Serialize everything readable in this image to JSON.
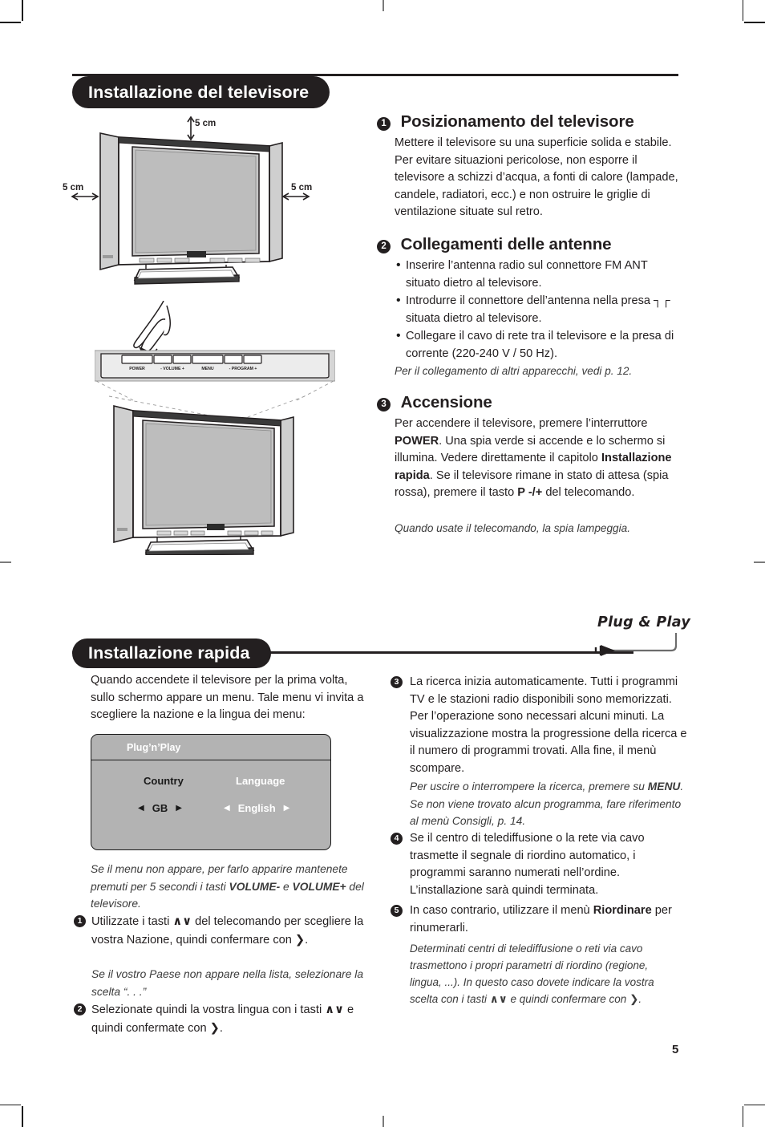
{
  "page": {
    "number": "5",
    "language": "it"
  },
  "section1": {
    "banner": "Installazione del televisore",
    "illustration": {
      "dim_top": "5 cm",
      "dim_left": "5 cm",
      "dim_right": "5 cm",
      "control_panel_labels": [
        "POWER",
        "- VOLUME +",
        "MENU",
        "- PROGRAM +"
      ]
    },
    "items": [
      {
        "num": "1",
        "heading": "Posizionamento del televisore",
        "body": "Mettere il televisore su una superficie solida e stabile. Per evitare situazioni pericolose, non esporre il televisore a schizzi d’acqua, a fonti di calore (lampade, candele, radiatori, ecc.) e non ostruire le griglie di ventilazione situate sul retro."
      },
      {
        "num": "2",
        "heading": "Collegamenti delle antenne",
        "bullets": [
          "Inserire l’antenna radio sul connettore FM ANT situato dietro al televisore.",
          "Introdurre il connettore dell’antenna nella presa ┐┌ situata dietro al televisore.",
          "Collegare il cavo di rete tra il televisore e la presa di corrente (220-240 V / 50 Hz)."
        ],
        "note": "Per il collegamento di altri apparecchi, vedi p. 12."
      },
      {
        "num": "3",
        "heading": "Accensione",
        "body_parts": [
          {
            "t": "Per accendere il televisore, premere l’interruttore ",
            "b": false
          },
          {
            "t": "POWER",
            "b": true
          },
          {
            "t": ". Una spia verde si accende e lo schermo si illumina. Vedere direttamente il capitolo ",
            "b": false
          },
          {
            "t": "Installazione rapida",
            "b": true
          },
          {
            "t": ". Se il televisore rimane in stato di attesa (spia rossa), premere il tasto ",
            "b": false
          },
          {
            "t": "P -/+",
            "b": true
          },
          {
            "t": " del telecomando.",
            "b": false
          }
        ],
        "note": "Quando usate il telecomando, la spia lampeggia."
      }
    ]
  },
  "section2": {
    "banner": "Installazione rapida",
    "logo": "Plug & Play",
    "intro": "Quando accendete il televisore per la prima volta, sullo schermo appare un menu. Tale menu vi invita a scegliere la nazione e la lingua dei menu:",
    "osd": {
      "title": "Plug’n’Play",
      "country_label": "Country",
      "language_label": "Language",
      "country_value": "GB",
      "language_value": "English",
      "arrow_left": "◀",
      "arrow_right": "▶"
    },
    "note_after_osd": [
      {
        "t": "Se il menu non appare, per farlo apparire mantenete premuti per 5 secondi i tasti ",
        "b": false
      },
      {
        "t": "VOLUME-",
        "b": true
      },
      {
        "t": " e ",
        "b": false
      },
      {
        "t": "VOLUME+",
        "b": true
      },
      {
        "t": " del televisore.",
        "b": false
      }
    ],
    "left_items": [
      {
        "num": "1",
        "parts": [
          {
            "t": "Utilizzate i tasti ",
            "b": false,
            "g": false
          },
          {
            "t": "∧∨",
            "b": true,
            "g": true
          },
          {
            "t": " del telecomando per scegliere la vostra Nazione, quindi confermare con ",
            "b": false,
            "g": false
          },
          {
            "t": "❯",
            "b": true,
            "g": true
          },
          {
            "t": ".",
            "b": false,
            "g": false
          }
        ],
        "note": "Se il vostro Paese non appare nella lista, selezionare la scelta “. . .”"
      },
      {
        "num": "2",
        "parts": [
          {
            "t": "Selezionate quindi la vostra lingua con i tasti ",
            "b": false,
            "g": false
          },
          {
            "t": "∧∨",
            "b": true,
            "g": true
          },
          {
            "t": " e quindi confermate con ",
            "b": false,
            "g": false
          },
          {
            "t": "❯",
            "b": true,
            "g": true
          },
          {
            "t": ".",
            "b": false,
            "g": false
          }
        ]
      }
    ],
    "right_items": [
      {
        "num": "3",
        "body": "La ricerca inizia automaticamente. Tutti i programmi TV e le stazioni radio disponibili sono memorizzati. Per l’operazione sono necessari alcuni minuti. La visualizzazione mostra la progressione della ricerca e il numero di programmi trovati. Alla fine, il menù scompare.",
        "note_parts": [
          {
            "t": "Per uscire o interrompere la ricerca, premere su ",
            "b": false
          },
          {
            "t": "MENU",
            "b": true
          },
          {
            "t": ". Se non viene trovato alcun programma, fare riferimento al menù Consigli, p. 14.",
            "b": false
          }
        ]
      },
      {
        "num": "4",
        "body": "Se il centro di telediffusione o la rete via cavo trasmette il segnale di riordino automatico, i programmi saranno numerati nell’ordine. L’installazione sarà quindi terminata."
      },
      {
        "num": "5",
        "parts": [
          {
            "t": "In caso contrario, utilizzare il menù ",
            "b": false,
            "g": false
          },
          {
            "t": "Riordinare",
            "b": true,
            "g": false
          },
          {
            "t": " per rinumerarli.",
            "b": false,
            "g": false
          }
        ],
        "note_parts": [
          {
            "t": "Determinati centri di telediffusione o reti via cavo trasmettono i propri parametri di riordino (regione, lingua, ...). In questo caso dovete indicare la vostra scelta con i tasti ",
            "b": false,
            "g": false
          },
          {
            "t": "∧∨",
            "b": false,
            "g": true
          },
          {
            "t": " e quindi confermare con ",
            "b": false,
            "g": false
          },
          {
            "t": "❯",
            "b": false,
            "g": true
          },
          {
            "t": ".",
            "b": false,
            "g": false
          }
        ]
      }
    ]
  }
}
